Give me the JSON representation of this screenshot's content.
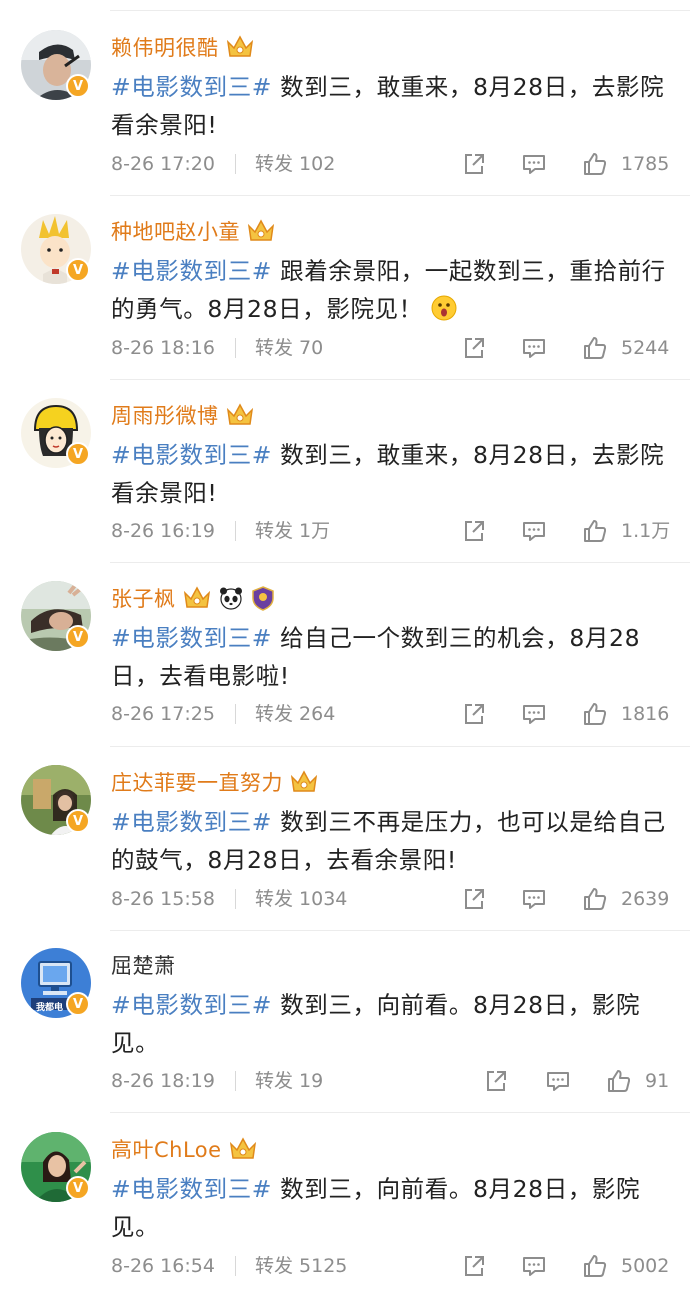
{
  "posts": [
    {
      "author": "赖伟明很酷",
      "hashtag": "#电影数到三#",
      "body": " 数到三，敢重来，8月28日，去影院看余景阳!",
      "time": "8-26 17:20",
      "repost": "转发 102",
      "likes": "1785",
      "verified": "V"
    },
    {
      "author": "种地吧赵小童",
      "hashtag": "#电影数到三#",
      "body": " 跟着余景阳，一起数到三，重拾前行的勇气。8月28日，影院见！",
      "time": "8-26 18:16",
      "repost": "转发 70",
      "likes": "5244",
      "verified": "V"
    },
    {
      "author": "周雨彤微博",
      "hashtag": "#电影数到三#",
      "body": " 数到三，敢重来，8月28日，去影院看余景阳!",
      "time": "8-26 16:19",
      "repost": "转发 1万",
      "likes": "1.1万",
      "verified": "V"
    },
    {
      "author": "张子枫",
      "hashtag": "#电影数到三#",
      "body": " 给自己一个数到三的机会，8月28日，去看电影啦!",
      "time": "8-26 17:25",
      "repost": "转发 264",
      "likes": "1816",
      "verified": "V"
    },
    {
      "author": "庄达菲要一直努力",
      "hashtag": "#电影数到三#",
      "body": " 数到三不再是压力，也可以是给自己的鼓气，8月28日，去看余景阳!",
      "time": "8-26 15:58",
      "repost": "转发 1034",
      "likes": "2639",
      "verified": "V"
    },
    {
      "author": "屈楚萧",
      "hashtag": "#电影数到三#",
      "body": " 数到三，向前看。8月28日，影院见。",
      "time": "8-26 18:19",
      "repost": "转发 19",
      "likes": "91",
      "verified": "V",
      "avatar_text": "我都电"
    },
    {
      "author": "高叶ChLoe",
      "hashtag": "#电影数到三#",
      "body": " 数到三，向前看。8月28日，影院见。",
      "time": "8-26 16:54",
      "repost": "转发 5125",
      "likes": "5002",
      "verified": "V"
    }
  ],
  "icons": {
    "share": "share-icon",
    "comment": "comment-icon",
    "like": "thumbs-up-icon",
    "crown": "crown-badge-icon",
    "panda": "panda-icon",
    "shield": "shield-badge-icon",
    "emoji": "surprised-emoji-icon"
  },
  "colors": {
    "author": "#e07b1a",
    "hashtag": "#4a7fc1",
    "meta": "#8d8d8d",
    "verified": "#f5a623"
  }
}
